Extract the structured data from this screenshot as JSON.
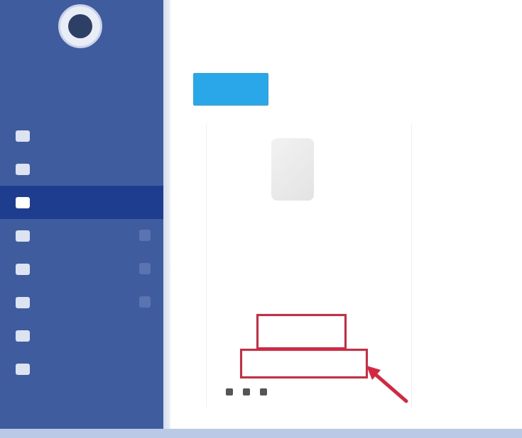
{
  "sidebar": {
    "profile_name": "",
    "profile_role": "",
    "items": [
      {
        "label": "",
        "active": false,
        "badge": false
      },
      {
        "label": "",
        "active": false,
        "badge": false
      },
      {
        "label": "",
        "active": true,
        "badge": false
      },
      {
        "label": "",
        "active": false,
        "badge": true
      },
      {
        "label": "",
        "active": false,
        "badge": true
      },
      {
        "label": "",
        "active": false,
        "badge": true
      },
      {
        "label": "",
        "active": false,
        "badge": false
      },
      {
        "label": "",
        "active": false,
        "badge": false
      }
    ]
  },
  "header": {
    "title": "",
    "subtitle": ""
  },
  "main": {
    "top_button_label": ""
  },
  "card": {
    "name": "",
    "role": "",
    "status": "",
    "link_text": "",
    "primary_action_label": "",
    "secondary_action_label": "",
    "footer_link": ""
  },
  "colors": {
    "sidebar": "#3f5c9e",
    "sidebar_active": "#1e3d8f",
    "primary_button": "#29a7e8",
    "highlight": "#d7263d"
  },
  "icons": [
    "avatar",
    "nav-item-icon",
    "arrow-annotation",
    "footer-icons"
  ]
}
